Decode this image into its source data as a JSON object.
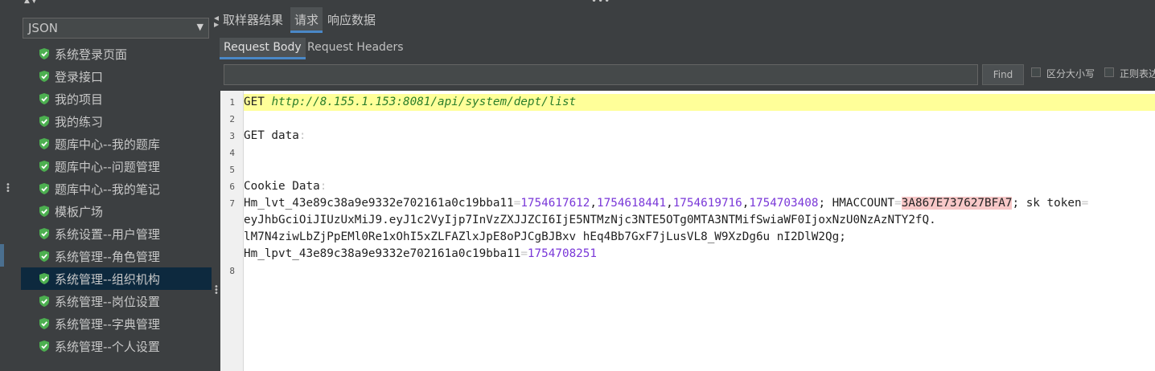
{
  "renderer": {
    "selected": "JSON"
  },
  "tree": {
    "items": [
      "系统登录页面",
      "登录接口",
      "我的项目",
      "我的练习",
      "题库中心--我的题库",
      "题库中心--问题管理",
      "题库中心--我的笔记",
      "模板广场",
      "系统设置--用户管理",
      "系统管理--角色管理",
      "系统管理--组织机构",
      "系统管理--岗位设置",
      "系统管理--字典管理",
      "系统管理--个人设置"
    ],
    "selected_index": 10,
    "status_color": "#4caf50"
  },
  "tabs": {
    "main": [
      "取样器结果",
      "请求",
      "响应数据"
    ],
    "active_main": 1,
    "sub": [
      "Request Body",
      "Request Headers"
    ],
    "active_sub": 0
  },
  "search": {
    "value": "",
    "find_label": "Find",
    "case_label": "区分大小写",
    "regex_label": "正则表达"
  },
  "editor": {
    "line_numbers": [
      "1",
      "2",
      "3",
      "4",
      "5",
      "6",
      "7",
      "8"
    ],
    "line1": {
      "method": "GET ",
      "url": "http://8.155.1.153:8081/api/system/dept/list"
    },
    "line3": {
      "label": "GET data",
      "sep": ":"
    },
    "line6": {
      "label": "Cookie Data",
      "sep": ":"
    },
    "line7": {
      "name1": "Hm_lvt_43e89c38a9e9332e702161a0c19bba11",
      "eq": "=",
      "v1": "1754617612",
      "v2": "1754618441",
      "v3": "1754619716",
      "v4": "1754703408",
      "comma": ",",
      "hmaccount_pre": "; HMACCOUNT",
      "hmaccount_val": "3A867E737627BFA7",
      "sk_token": "; sk token",
      "token_line2": "eyJhbGciOiJIUzUxMiJ9.eyJ1c2VyIjp7InVzZXJJZCI6IjE5NTMzNjc3NTE5OTg0MTA3NTMifSwiaWF0IjoxNzU0NzAzNTY2fQ.",
      "token_line3": "lM7N4ziwLbZjPpEMl0Re1xOhI5xZLFAZlxJpE8oPJCgBJBxv hEq4Bb7GxF7jLusVL8_W9XzDg6u nI2DlW2Qg;",
      "name2": "Hm_lpvt_43e89c38a9e9332e702161a0c19bba11",
      "v5": "1754708251"
    },
    "highlight_color": "#ffff99"
  }
}
